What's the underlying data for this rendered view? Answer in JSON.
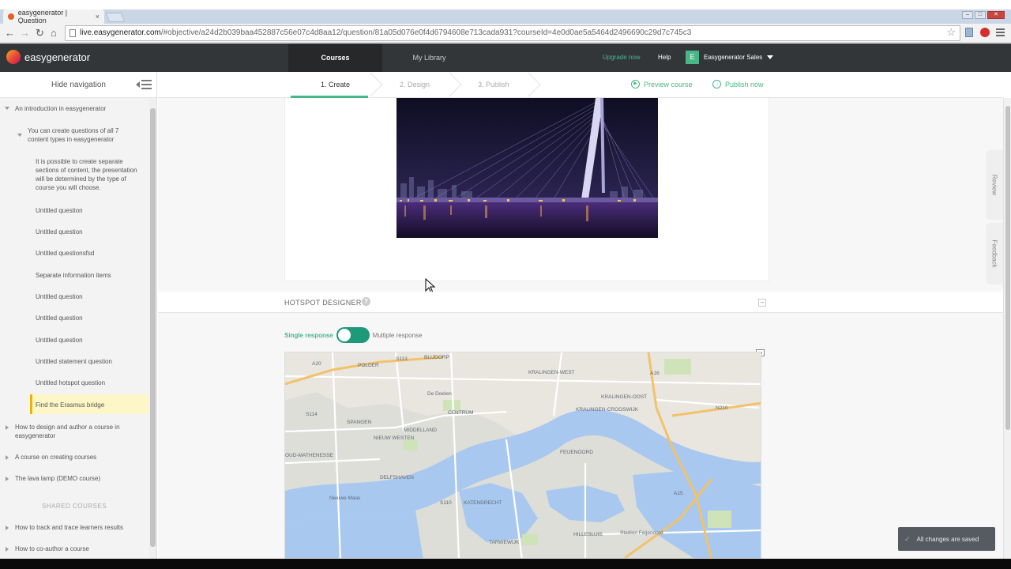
{
  "browser": {
    "tab_title": "easygenerator | Question",
    "tab_close": "×",
    "url_host": "live.easygenerator.com",
    "url_path": "/#objective/a24d2b039baa452887c56e07c4d8aa12/question/81a05d076e0f4d6794608e713cada931?courseId=4e0d0ae5a5464d2496690c29d7c745c3",
    "back": "←",
    "forward": "→",
    "reload": "↻",
    "home": "⌂",
    "star": "☆",
    "win_min": "–",
    "win_max": "□",
    "win_close": "✕"
  },
  "app": {
    "brand": "easygenerator",
    "nav": {
      "courses": "Courses",
      "my_library": "My Library"
    },
    "upgrade": "Upgrade now",
    "help": "Help",
    "user_initial": "E",
    "user_name": "Easygenerator Sales"
  },
  "stepper": {
    "create": "1. Create",
    "design": "2. Design",
    "publish": "3. Publish",
    "preview": "Preview course",
    "publish_now": "Publish now"
  },
  "sidebar": {
    "hide_navigation": "Hide navigation",
    "course1": "An introduction in easygenerator",
    "objective1": "You can create questions of all 7 content types in easygenerator",
    "items": [
      "It is possible to create separate sections of content, the presentation will be determined by the type of course you will choose.",
      "Untitled question",
      "Untitled question",
      "Untitled questionsfsd",
      "Separate information items",
      "Untitled question",
      "Untitled question",
      "Untitled question",
      "Untitled statement question",
      "Untitled hotspot question",
      "Find the Erasmus bridge"
    ],
    "courses": [
      "How to design and author a course in easygenerator",
      "A course on creating courses",
      "The lava lamp (DEMO course)"
    ],
    "shared_heading": "SHARED COURSES",
    "shared": [
      "How to track and trace learners results",
      "How to co-author a course"
    ]
  },
  "hotspot": {
    "title": "HOTSPOT DESIGNER",
    "help": "?",
    "collapse": "–",
    "single": "Single response",
    "multiple": "Multiple response"
  },
  "map_labels": {
    "a20": "A20",
    "polder": "POLDER",
    "s113": "S113",
    "bergpolder": "BLIJDORP",
    "a16": "A16",
    "kralingen_west": "KRALINGEN-WEST",
    "kralingen_oost": "KRALINGEN-OOST",
    "de_doelen": "De Doelen",
    "centrum": "CENTRUM",
    "kralingen_crooswijk": "KRALINGEN-CROOSWIJK",
    "s114": "S114",
    "spangen": "SPANGEN",
    "nieuw_westen": "NIEUW WESTEN",
    "middelland": "MIDDELLAND",
    "n210": "N210",
    "oud_mathenesse": "OUD-MATHENESSE",
    "feijenoord": "FEIJENOORD",
    "delfshaven": "DELFSHAVEN",
    "nieuwe_maas": "Nieuwe Maas",
    "katendrecht": "KATENDRECHT",
    "s110": "S110",
    "stadion": "Stadion Feijenoord",
    "tarwewijk": "TARWEWIJK",
    "hillesluis": "HILLESLUIS",
    "a15": "A15"
  },
  "right_tabs": {
    "review": "Review",
    "feedback": "Feedback"
  },
  "toast": {
    "check": "✓",
    "text": "All changes are saved"
  }
}
